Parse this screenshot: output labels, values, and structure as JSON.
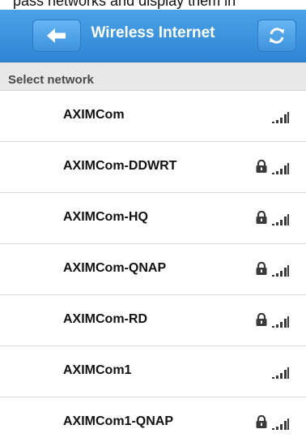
{
  "top_text": "pass networks and display them in",
  "header": {
    "title": "Wireless Internet",
    "back_icon": "arrow-left-icon",
    "refresh_icon": "refresh-icon",
    "color": "#3a92dc"
  },
  "section": {
    "title": "Select network"
  },
  "networks": [
    {
      "ssid": "AXIMCom",
      "secured": false,
      "signal": "signal-icon"
    },
    {
      "ssid": "AXIMCom-DDWRT",
      "secured": true,
      "signal": "signal-icon"
    },
    {
      "ssid": "AXIMCom-HQ",
      "secured": true,
      "signal": "signal-icon"
    },
    {
      "ssid": "AXIMCom-QNAP",
      "secured": true,
      "signal": "signal-icon"
    },
    {
      "ssid": "AXIMCom-RD",
      "secured": true,
      "signal": "signal-icon"
    },
    {
      "ssid": "AXIMCom1",
      "secured": false,
      "signal": "signal-icon"
    },
    {
      "ssid": "AXIMCom1-QNAP",
      "secured": true,
      "signal": "signal-icon"
    }
  ]
}
